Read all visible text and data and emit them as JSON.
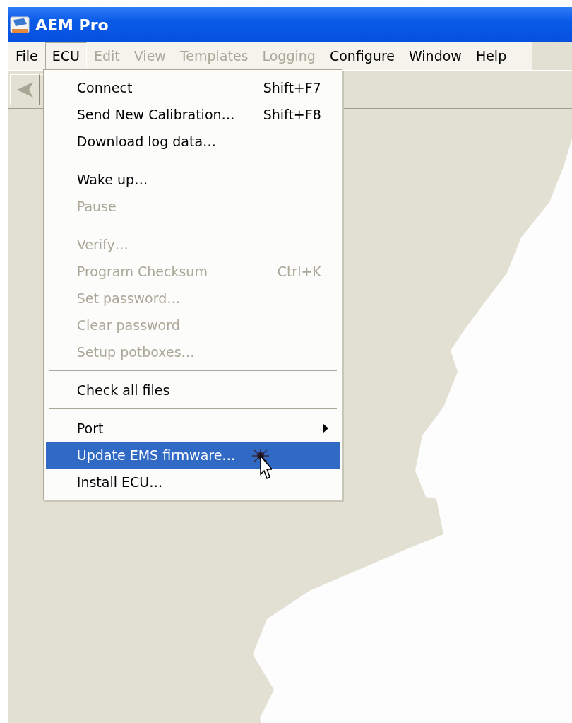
{
  "window": {
    "title": "AEM Pro"
  },
  "menubar": [
    {
      "label": "File",
      "disabled": false,
      "selected": false
    },
    {
      "label": "ECU",
      "disabled": false,
      "selected": true
    },
    {
      "label": "Edit",
      "disabled": true,
      "selected": false
    },
    {
      "label": "View",
      "disabled": true,
      "selected": false
    },
    {
      "label": "Templates",
      "disabled": true,
      "selected": false
    },
    {
      "label": "Logging",
      "disabled": true,
      "selected": false
    },
    {
      "label": "Configure",
      "disabled": false,
      "selected": false
    },
    {
      "label": "Window",
      "disabled": false,
      "selected": false
    },
    {
      "label": "Help",
      "disabled": false,
      "selected": false
    }
  ],
  "menu": [
    {
      "kind": "item",
      "label": "Connect",
      "shortcut": "Shift+F7",
      "disabled": false,
      "selected": false
    },
    {
      "kind": "item",
      "label": "Send New Calibration…",
      "shortcut": "Shift+F8",
      "disabled": false,
      "selected": false
    },
    {
      "kind": "item",
      "label": "Download log data…",
      "disabled": false,
      "selected": false
    },
    {
      "kind": "separator"
    },
    {
      "kind": "item",
      "label": "Wake up…",
      "disabled": false,
      "selected": false
    },
    {
      "kind": "item",
      "label": "Pause",
      "disabled": true,
      "selected": false
    },
    {
      "kind": "separator"
    },
    {
      "kind": "item",
      "label": "Verify…",
      "disabled": true,
      "selected": false
    },
    {
      "kind": "item",
      "label": "Program Checksum",
      "shortcut": "Ctrl+K",
      "disabled": true,
      "selected": false
    },
    {
      "kind": "item",
      "label": "Set password…",
      "disabled": true,
      "selected": false
    },
    {
      "kind": "item",
      "label": "Clear password",
      "disabled": true,
      "selected": false
    },
    {
      "kind": "item",
      "label": "Setup potboxes…",
      "disabled": true,
      "selected": false
    },
    {
      "kind": "separator"
    },
    {
      "kind": "item",
      "label": "Check all files",
      "disabled": false,
      "selected": false
    },
    {
      "kind": "separator"
    },
    {
      "kind": "submenu",
      "label": "Port",
      "disabled": false,
      "selected": false
    },
    {
      "kind": "item",
      "label": "Update EMS firmware…",
      "disabled": false,
      "selected": true
    },
    {
      "kind": "item",
      "label": "Install ECU…",
      "disabled": false,
      "selected": false
    }
  ]
}
